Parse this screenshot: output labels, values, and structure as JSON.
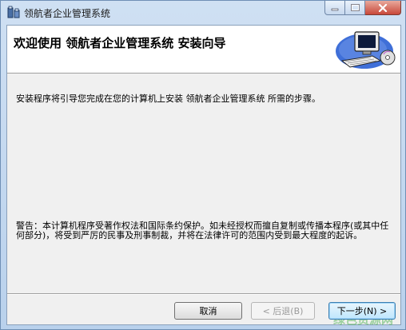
{
  "window": {
    "title": "领航者企业管理系统"
  },
  "header": {
    "title": "欢迎使用  领航者企业管理系统  安装向导"
  },
  "body": {
    "intro": "安装程序将引导您完成在您的计算机上安装 领航者企业管理系统 所需的步骤。",
    "warning": "警告：本计算机程序受著作权法和国际条约保护。如未经授权而擅自复制或传播本程序(或其中任何部分)，将受到严厉的民事及刑事制裁，并将在法律许可的范围内受到最大程度的起诉。"
  },
  "buttons": {
    "cancel": "取消",
    "back": "< 后退(B)",
    "next": "下一步(N) >"
  },
  "watermark": "绿色资源网",
  "colors": {
    "titlebar": "#c4d8ef",
    "close_button": "#c8483a",
    "client_bg": "#f0f0f0"
  }
}
